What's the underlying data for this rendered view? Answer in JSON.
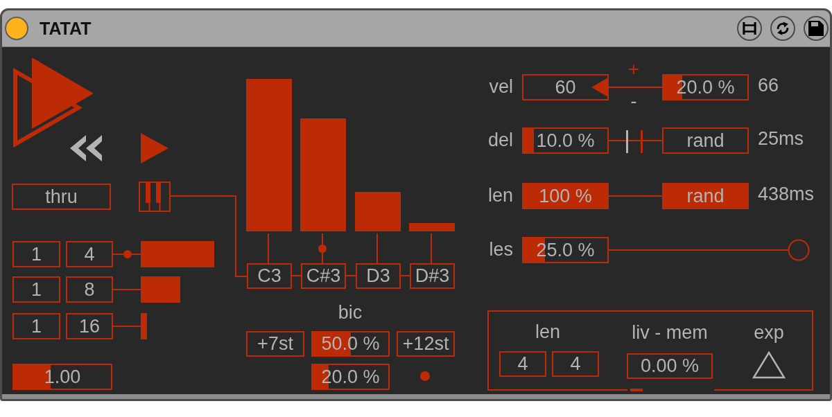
{
  "device": {
    "title": "TATAT",
    "on": true
  },
  "transport": {
    "mode": "thru"
  },
  "divisions": [
    {
      "numerator": "1",
      "denominator": "4",
      "selected": true,
      "level": 1
    },
    {
      "numerator": "1",
      "denominator": "8",
      "selected": false,
      "level": 0.54
    },
    {
      "numerator": "1",
      "denominator": "16",
      "selected": false,
      "level": 0.085
    }
  ],
  "rate": {
    "text": "1.00",
    "level": 0.38
  },
  "notes": [
    {
      "name": "C3",
      "level": 1,
      "selected": false
    },
    {
      "name": "C#3",
      "level": 0.74,
      "selected": true
    },
    {
      "name": "D3",
      "level": 0.26,
      "selected": false
    },
    {
      "name": "D#3",
      "level": 0.055,
      "selected": false
    }
  ],
  "bic": {
    "label": "bic",
    "low": "+7st",
    "mix": {
      "text": "50.0 %",
      "level": 0.5
    },
    "high": "+12st",
    "chance": {
      "text": "20.0 %",
      "level": 0.21
    },
    "indicator_on": true
  },
  "params": [
    {
      "kind": "arrow",
      "label": "vel",
      "value": "60",
      "plus": "+",
      "minus": "-",
      "amount": {
        "text": "20.0 %",
        "level": 0.22
      },
      "reading": "66"
    },
    {
      "kind": "ticks",
      "label": "del",
      "amount": {
        "text": "10.0 %",
        "level": 0.12
      },
      "mode": {
        "text": "rand",
        "on": false
      },
      "reading": "25ms"
    },
    {
      "kind": "plain",
      "label": "len",
      "amount": {
        "text": "100 %",
        "level": 1
      },
      "mode": {
        "text": "rand",
        "on": true
      },
      "reading": "438ms"
    },
    {
      "kind": "knob",
      "label": "les",
      "amount": {
        "text": "25.0 %",
        "level": 0.26
      }
    }
  ],
  "memory": {
    "len_label": "len",
    "len_values": [
      "4",
      "4"
    ],
    "mem_label": "liv - mem",
    "mem_value": "0.00 %",
    "exp_label": "exp"
  }
}
